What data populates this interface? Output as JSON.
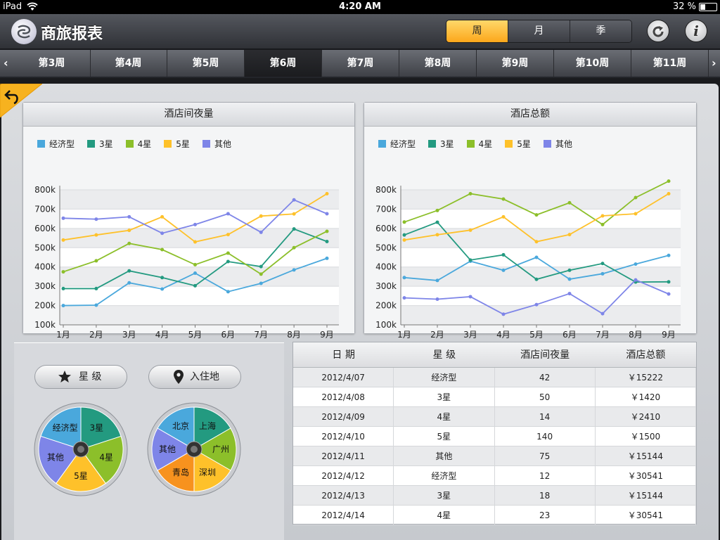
{
  "statusbar": {
    "carrier": "iPad",
    "time": "4:20 AM",
    "battery": "32 %"
  },
  "app": {
    "title": "商旅报表"
  },
  "period_tabs": [
    {
      "label": "周",
      "active": true
    },
    {
      "label": "月",
      "active": false
    },
    {
      "label": "季",
      "active": false
    }
  ],
  "toolbar": {
    "refresh_icon": "refresh-icon",
    "info_label": "i"
  },
  "weeks": [
    {
      "label": "第3周",
      "active": false
    },
    {
      "label": "第4周",
      "active": false
    },
    {
      "label": "第5周",
      "active": false
    },
    {
      "label": "第6周",
      "active": true
    },
    {
      "label": "第7周",
      "active": false
    },
    {
      "label": "第8周",
      "active": false
    },
    {
      "label": "第9周",
      "active": false
    },
    {
      "label": "第10周",
      "active": false
    },
    {
      "label": "第11周",
      "active": false
    }
  ],
  "colors": {
    "经济型": "#4aa8dc",
    "3星": "#239a80",
    "4星": "#8cbf2a",
    "5星": "#fec12a",
    "其他": "#7e85e8",
    "accent": "#fca71b"
  },
  "chart_data": [
    {
      "type": "line",
      "title": "酒店间夜量",
      "categories": [
        "1月",
        "2月",
        "3月",
        "4月",
        "5月",
        "6月",
        "7月",
        "8月",
        "9月"
      ],
      "ylim": [
        100000,
        800000
      ],
      "yticks": [
        "100k",
        "200k",
        "300k",
        "400k",
        "500k",
        "600k",
        "700k",
        "800k"
      ],
      "grid": true,
      "legend": "top-left",
      "series": [
        {
          "name": "经济型",
          "color": "#4aa8dc",
          "values": [
            200000,
            202000,
            318000,
            286000,
            368000,
            272000,
            315000,
            385000,
            445000
          ]
        },
        {
          "name": "3星",
          "color": "#239a80",
          "values": [
            288000,
            288000,
            380000,
            345000,
            303000,
            428000,
            402000,
            597000,
            532000
          ]
        },
        {
          "name": "4星",
          "color": "#8cbf2a",
          "values": [
            375000,
            432000,
            522000,
            490000,
            412000,
            472000,
            363000,
            500000,
            585000
          ]
        },
        {
          "name": "5星",
          "color": "#fec12a",
          "values": [
            540000,
            566000,
            590000,
            660000,
            530000,
            568000,
            664000,
            675000,
            780000
          ]
        },
        {
          "name": "其他",
          "color": "#7e85e8",
          "values": [
            653000,
            648000,
            660000,
            575000,
            620000,
            676000,
            580000,
            748000,
            676000
          ]
        }
      ]
    },
    {
      "type": "line",
      "title": "酒店总额",
      "categories": [
        "1月",
        "2月",
        "3月",
        "4月",
        "5月",
        "6月",
        "7月",
        "8月",
        "9月"
      ],
      "ylim": [
        100000,
        800000
      ],
      "yticks": [
        "100k",
        "200k",
        "300k",
        "400k",
        "500k",
        "600k",
        "700k",
        "800k"
      ],
      "grid": true,
      "legend": "top-left",
      "series": [
        {
          "name": "经济型",
          "color": "#4aa8dc",
          "values": [
            345000,
            330000,
            430000,
            383000,
            450000,
            337000,
            365000,
            415000,
            460000
          ]
        },
        {
          "name": "3星",
          "color": "#239a80",
          "values": [
            566000,
            632000,
            436000,
            463000,
            336000,
            383000,
            418000,
            322000,
            323000
          ]
        },
        {
          "name": "4星",
          "color": "#8cbf2a",
          "values": [
            633000,
            693000,
            780000,
            752000,
            670000,
            733000,
            620000,
            760000,
            845000
          ]
        },
        {
          "name": "5星",
          "color": "#fec12a",
          "values": [
            540000,
            567000,
            591000,
            660000,
            531000,
            568000,
            665000,
            676000,
            780000
          ]
        },
        {
          "name": "其他",
          "color": "#7e85e8",
          "values": [
            240000,
            233000,
            246000,
            155000,
            205000,
            262000,
            158000,
            333000,
            260000
          ]
        }
      ]
    }
  ],
  "filters": {
    "star_label": "星 级",
    "location_label": "入住地"
  },
  "star_wheel": [
    "经济型",
    "3星",
    "4星",
    "5星",
    "其他"
  ],
  "city_wheel": [
    "北京",
    "上海",
    "广州",
    "深圳",
    "青岛",
    "其他"
  ],
  "table": {
    "headers": [
      "日 期",
      "星 级",
      "酒店间夜量",
      "酒店总额"
    ],
    "rows": [
      [
        "2012/4/07",
        "经济型",
        "42",
        "￥15222"
      ],
      [
        "2012/4/08",
        "3星",
        "50",
        "￥1420"
      ],
      [
        "2012/4/09",
        "4星",
        "14",
        "￥2410"
      ],
      [
        "2012/4/10",
        "5星",
        "140",
        "￥1500"
      ],
      [
        "2012/4/11",
        "其他",
        "75",
        "￥15144"
      ],
      [
        "2012/4/12",
        "经济型",
        "12",
        "￥30541"
      ],
      [
        "2012/4/13",
        "3星",
        "18",
        "￥15144"
      ],
      [
        "2012/4/14",
        "4星",
        "23",
        "￥30541"
      ]
    ]
  }
}
